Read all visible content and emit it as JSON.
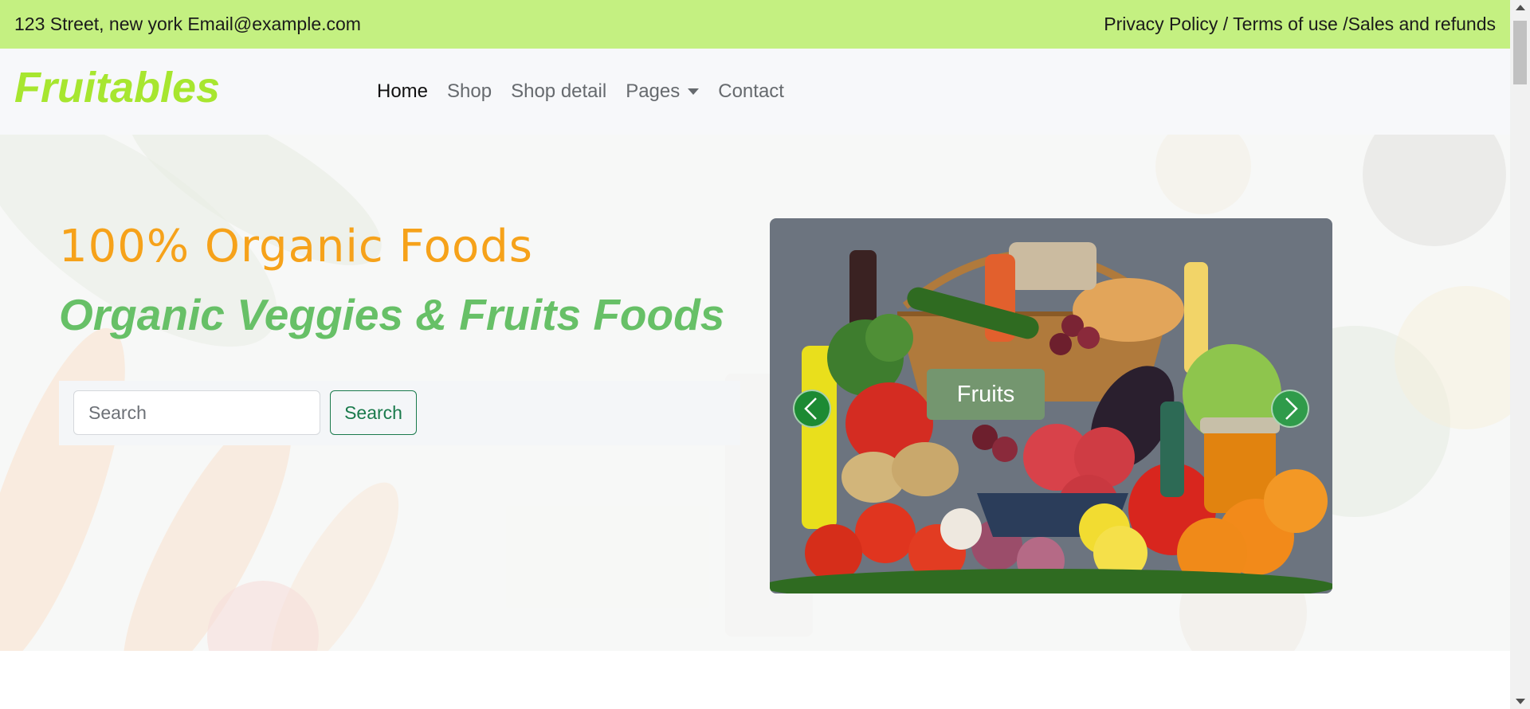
{
  "topbar": {
    "address_email": "123 Street, new york Email@example.com",
    "links_text": "Privacy Policy / Terms of use /Sales and refunds"
  },
  "navbar": {
    "brand": "Fruitables",
    "items": [
      {
        "label": "Home",
        "active": true
      },
      {
        "label": "Shop"
      },
      {
        "label": "Shop detail"
      },
      {
        "label": "Pages",
        "dropdown": true
      },
      {
        "label": "Contact"
      }
    ]
  },
  "hero": {
    "subtitle": "100% Organic Foods",
    "title": "Organic Veggies & Fruits Foods",
    "search": {
      "placeholder": "Search",
      "button": "Search"
    },
    "carousel": {
      "active_label": "Fruits"
    }
  },
  "colors": {
    "topbar_bg": "#c4f081",
    "brand": "#a7e62f",
    "subtitle": "#f6a21a",
    "title": "#67c067",
    "search_button": "#1a7a4c",
    "carousel_bg": "#6c747f",
    "slide_label_bg": "#74966f"
  },
  "icons": {
    "prev": "chevron-left-icon",
    "next": "chevron-right-icon",
    "dropdown": "caret-down-icon"
  }
}
